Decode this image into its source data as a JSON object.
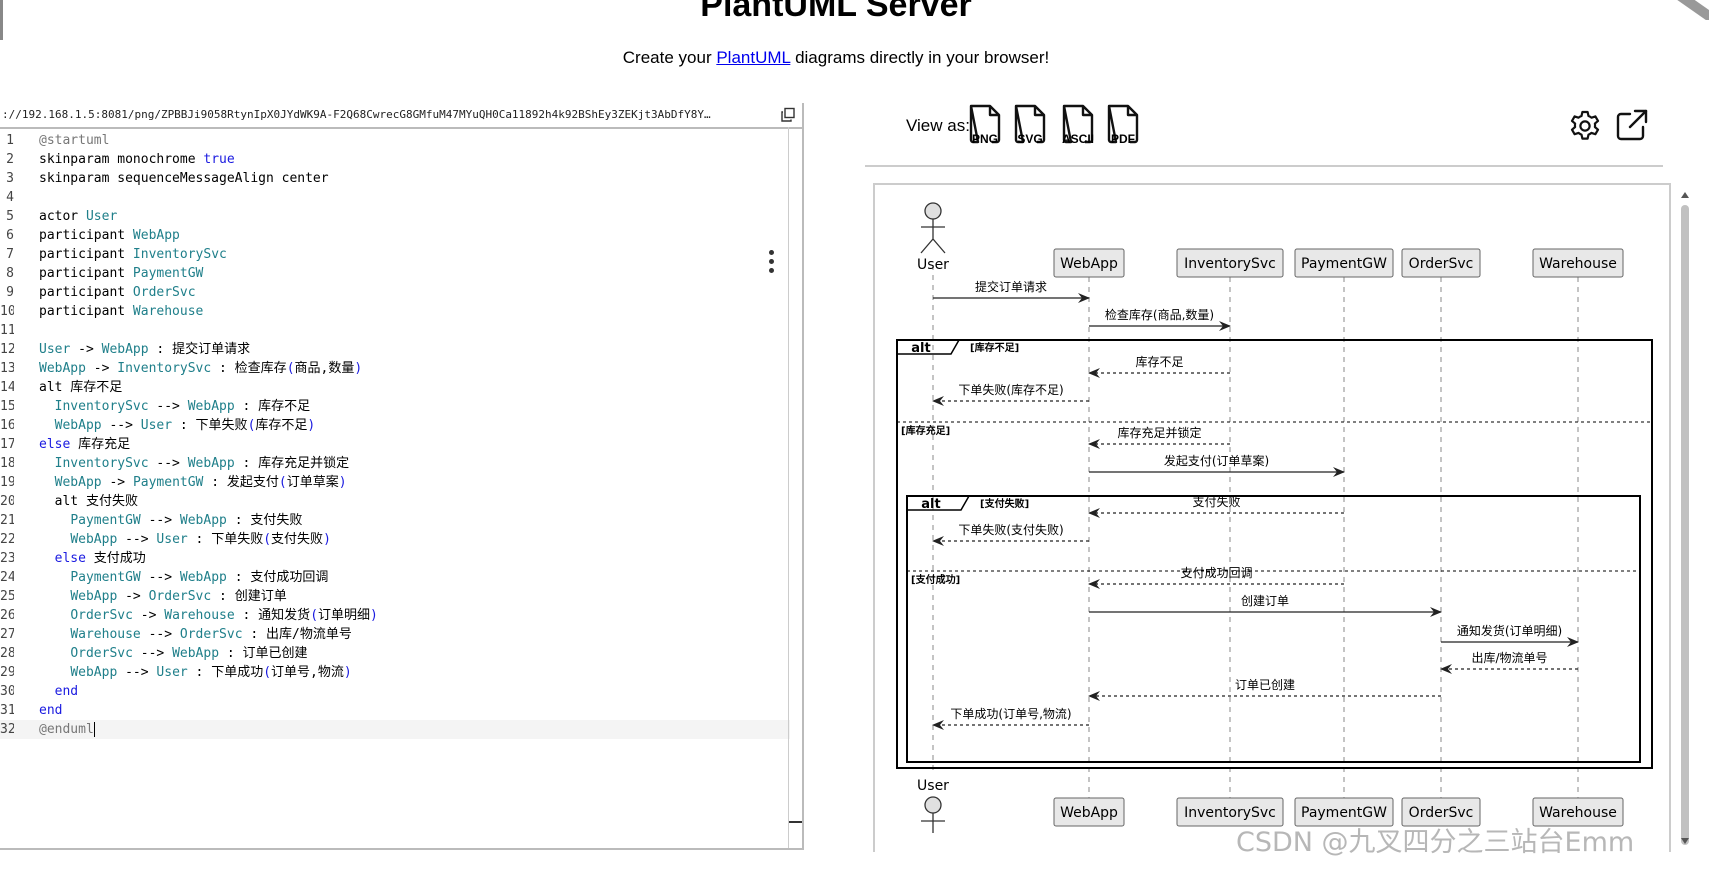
{
  "header": {
    "title": "PlantUML Server",
    "subtitle_before": "Create your ",
    "subtitle_link": "PlantUML",
    "subtitle_after": " diagrams directly in your browser!"
  },
  "editor": {
    "url": "://192.168.1.5:8081/png/ZPBBJi9058RtynIpX0JYdWK9A-F2Q68CwrecG8GMfuM47MYuQH0Ca11892h4k92BShEy3ZEKjt3AbDfY8Y…",
    "lines": [
      {
        "n": "1",
        "segs": [
          {
            "t": "@startuml",
            "c": "g"
          }
        ]
      },
      {
        "n": "2",
        "segs": [
          {
            "t": "skinparam monochrome ",
            "c": ""
          },
          {
            "t": "true",
            "c": "b"
          }
        ]
      },
      {
        "n": "3",
        "segs": [
          {
            "t": "skinparam sequenceMessageAlign center",
            "c": ""
          }
        ]
      },
      {
        "n": "4",
        "segs": []
      },
      {
        "n": "5",
        "segs": [
          {
            "t": "actor ",
            "c": ""
          },
          {
            "t": "User",
            "c": "t"
          }
        ]
      },
      {
        "n": "6",
        "segs": [
          {
            "t": "participant ",
            "c": ""
          },
          {
            "t": "WebApp",
            "c": "t"
          }
        ]
      },
      {
        "n": "7",
        "segs": [
          {
            "t": "participant ",
            "c": ""
          },
          {
            "t": "InventorySvc",
            "c": "t"
          }
        ]
      },
      {
        "n": "8",
        "segs": [
          {
            "t": "participant ",
            "c": ""
          },
          {
            "t": "PaymentGW",
            "c": "t"
          }
        ]
      },
      {
        "n": "9",
        "segs": [
          {
            "t": "participant ",
            "c": ""
          },
          {
            "t": "OrderSvc",
            "c": "t"
          }
        ]
      },
      {
        "n": "10",
        "segs": [
          {
            "t": "participant ",
            "c": ""
          },
          {
            "t": "Warehouse",
            "c": "t"
          }
        ]
      },
      {
        "n": "11",
        "segs": []
      },
      {
        "n": "12",
        "segs": [
          {
            "t": "User",
            "c": "t"
          },
          {
            "t": " -> ",
            "c": ""
          },
          {
            "t": "WebApp",
            "c": "t"
          },
          {
            "t": " : 提交订单请求",
            "c": ""
          }
        ]
      },
      {
        "n": "13",
        "segs": [
          {
            "t": "WebApp",
            "c": "t"
          },
          {
            "t": " -> ",
            "c": ""
          },
          {
            "t": "InventorySvc",
            "c": "t"
          },
          {
            "t": " : 检查库存",
            "c": ""
          },
          {
            "t": "(",
            "c": "b"
          },
          {
            "t": "商品,数量",
            "c": ""
          },
          {
            "t": ")",
            "c": "b"
          }
        ]
      },
      {
        "n": "14",
        "segs": [
          {
            "t": "alt 库存不足",
            "c": ""
          }
        ]
      },
      {
        "n": "15",
        "segs": [
          {
            "t": "  ",
            "c": ""
          },
          {
            "t": "InventorySvc",
            "c": "t"
          },
          {
            "t": " --> ",
            "c": ""
          },
          {
            "t": "WebApp",
            "c": "t"
          },
          {
            "t": " : 库存不足",
            "c": ""
          }
        ]
      },
      {
        "n": "16",
        "segs": [
          {
            "t": "  ",
            "c": ""
          },
          {
            "t": "WebApp",
            "c": "t"
          },
          {
            "t": " --> ",
            "c": ""
          },
          {
            "t": "User",
            "c": "t"
          },
          {
            "t": " : 下单失败",
            "c": ""
          },
          {
            "t": "(",
            "c": "b"
          },
          {
            "t": "库存不足",
            "c": ""
          },
          {
            "t": ")",
            "c": "b"
          }
        ]
      },
      {
        "n": "17",
        "segs": [
          {
            "t": "else",
            "c": "b"
          },
          {
            "t": " 库存充足",
            "c": ""
          }
        ]
      },
      {
        "n": "18",
        "segs": [
          {
            "t": "  ",
            "c": ""
          },
          {
            "t": "InventorySvc",
            "c": "t"
          },
          {
            "t": " --> ",
            "c": ""
          },
          {
            "t": "WebApp",
            "c": "t"
          },
          {
            "t": " : 库存充足并锁定",
            "c": ""
          }
        ]
      },
      {
        "n": "19",
        "segs": [
          {
            "t": "  ",
            "c": ""
          },
          {
            "t": "WebApp",
            "c": "t"
          },
          {
            "t": " -> ",
            "c": ""
          },
          {
            "t": "PaymentGW",
            "c": "t"
          },
          {
            "t": " : 发起支付",
            "c": ""
          },
          {
            "t": "(",
            "c": "b"
          },
          {
            "t": "订单草案",
            "c": ""
          },
          {
            "t": ")",
            "c": "b"
          }
        ]
      },
      {
        "n": "20",
        "segs": [
          {
            "t": "  alt 支付失败",
            "c": ""
          }
        ]
      },
      {
        "n": "21",
        "segs": [
          {
            "t": "    ",
            "c": ""
          },
          {
            "t": "PaymentGW",
            "c": "t"
          },
          {
            "t": " --> ",
            "c": ""
          },
          {
            "t": "WebApp",
            "c": "t"
          },
          {
            "t": " : 支付失败",
            "c": ""
          }
        ]
      },
      {
        "n": "22",
        "segs": [
          {
            "t": "    ",
            "c": ""
          },
          {
            "t": "WebApp",
            "c": "t"
          },
          {
            "t": " --> ",
            "c": ""
          },
          {
            "t": "User",
            "c": "t"
          },
          {
            "t": " : 下单失败",
            "c": ""
          },
          {
            "t": "(",
            "c": "b"
          },
          {
            "t": "支付失败",
            "c": ""
          },
          {
            "t": ")",
            "c": "b"
          }
        ]
      },
      {
        "n": "23",
        "segs": [
          {
            "t": "  ",
            "c": ""
          },
          {
            "t": "else",
            "c": "b"
          },
          {
            "t": " 支付成功",
            "c": ""
          }
        ]
      },
      {
        "n": "24",
        "segs": [
          {
            "t": "    ",
            "c": ""
          },
          {
            "t": "PaymentGW",
            "c": "t"
          },
          {
            "t": " --> ",
            "c": ""
          },
          {
            "t": "WebApp",
            "c": "t"
          },
          {
            "t": " : 支付成功回调",
            "c": ""
          }
        ]
      },
      {
        "n": "25",
        "segs": [
          {
            "t": "    ",
            "c": ""
          },
          {
            "t": "WebApp",
            "c": "t"
          },
          {
            "t": " -> ",
            "c": ""
          },
          {
            "t": "OrderSvc",
            "c": "t"
          },
          {
            "t": " : 创建订单",
            "c": ""
          }
        ]
      },
      {
        "n": "26",
        "segs": [
          {
            "t": "    ",
            "c": ""
          },
          {
            "t": "OrderSvc",
            "c": "t"
          },
          {
            "t": " -> ",
            "c": ""
          },
          {
            "t": "Warehouse",
            "c": "t"
          },
          {
            "t": " : 通知发货",
            "c": ""
          },
          {
            "t": "(",
            "c": "b"
          },
          {
            "t": "订单明细",
            "c": ""
          },
          {
            "t": ")",
            "c": "b"
          }
        ]
      },
      {
        "n": "27",
        "segs": [
          {
            "t": "    ",
            "c": ""
          },
          {
            "t": "Warehouse",
            "c": "t"
          },
          {
            "t": " --> ",
            "c": ""
          },
          {
            "t": "OrderSvc",
            "c": "t"
          },
          {
            "t": " : 出库/物流单号",
            "c": ""
          }
        ]
      },
      {
        "n": "28",
        "segs": [
          {
            "t": "    ",
            "c": ""
          },
          {
            "t": "OrderSvc",
            "c": "t"
          },
          {
            "t": " --> ",
            "c": ""
          },
          {
            "t": "WebApp",
            "c": "t"
          },
          {
            "t": " : 订单已创建",
            "c": ""
          }
        ]
      },
      {
        "n": "29",
        "segs": [
          {
            "t": "    ",
            "c": ""
          },
          {
            "t": "WebApp",
            "c": "t"
          },
          {
            "t": " --> ",
            "c": ""
          },
          {
            "t": "User",
            "c": "t"
          },
          {
            "t": " : 下单成功",
            "c": ""
          },
          {
            "t": "(",
            "c": "b"
          },
          {
            "t": "订单号,物流",
            "c": ""
          },
          {
            "t": ")",
            "c": "b"
          }
        ]
      },
      {
        "n": "30",
        "segs": [
          {
            "t": "  ",
            "c": ""
          },
          {
            "t": "end",
            "c": "b"
          }
        ]
      },
      {
        "n": "31",
        "segs": [
          {
            "t": "end",
            "c": "b"
          }
        ]
      },
      {
        "n": "32",
        "segs": [
          {
            "t": "@enduml",
            "c": "g"
          }
        ],
        "active": true
      }
    ]
  },
  "view": {
    "label": "View as:",
    "formats": [
      "PNG",
      "SVG",
      "ASCII",
      "PDF"
    ]
  },
  "diagram": {
    "participants": [
      "User",
      "WebApp",
      "InventorySvc",
      "PaymentGW",
      "OrderSvc",
      "Warehouse"
    ],
    "messages": [
      {
        "from": 0,
        "to": 1,
        "text": "提交订单请求",
        "dashed": false
      },
      {
        "from": 1,
        "to": 2,
        "text": "检查库存(商品,数量)",
        "dashed": false
      },
      {
        "from": 2,
        "to": 1,
        "text": "库存不足",
        "dashed": true
      },
      {
        "from": 1,
        "to": 0,
        "text": "下单失败(库存不足)",
        "dashed": true
      },
      {
        "from": 2,
        "to": 1,
        "text": "库存充足并锁定",
        "dashed": true
      },
      {
        "from": 1,
        "to": 3,
        "text": "发起支付(订单草案)",
        "dashed": false
      },
      {
        "from": 3,
        "to": 1,
        "text": "支付失败",
        "dashed": true
      },
      {
        "from": 1,
        "to": 0,
        "text": "下单失败(支付失败)",
        "dashed": true
      },
      {
        "from": 3,
        "to": 1,
        "text": "支付成功回调",
        "dashed": true
      },
      {
        "from": 1,
        "to": 4,
        "text": "创建订单",
        "dashed": false
      },
      {
        "from": 4,
        "to": 5,
        "text": "通知发货(订单明细)",
        "dashed": false
      },
      {
        "from": 5,
        "to": 4,
        "text": "出库/物流单号",
        "dashed": true
      },
      {
        "from": 4,
        "to": 1,
        "text": "订单已创建",
        "dashed": true
      },
      {
        "from": 1,
        "to": 0,
        "text": "下单成功(订单号,物流)",
        "dashed": true
      }
    ],
    "fragments": [
      {
        "kind": "alt",
        "condition": "[库存不足]",
        "else_condition": "[库存充足]"
      },
      {
        "kind": "alt",
        "condition": "[支付失败]",
        "else_condition": "[支付成功]"
      }
    ]
  },
  "watermark": "CSDN @九叉四分之三站台Emm"
}
